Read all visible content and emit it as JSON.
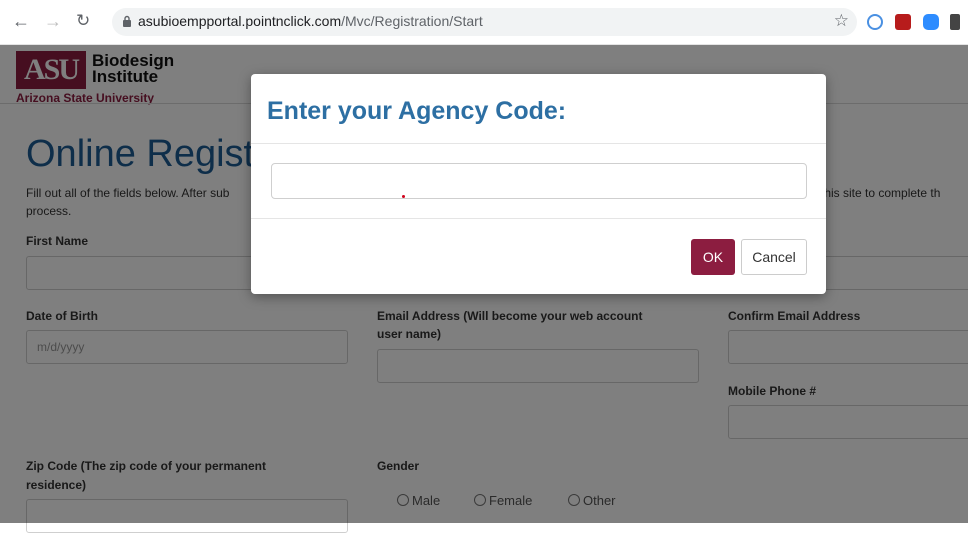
{
  "browser": {
    "url_host": "asubioempportal.pointnclick.com",
    "url_path": "/Mvc/Registration/Start",
    "icons": [
      "back-icon",
      "forward-icon",
      "reload-icon",
      "lock-icon",
      "star-icon"
    ]
  },
  "header": {
    "logo_mark": "ASU",
    "logo_line1": "Biodesign",
    "logo_line2": "Institute",
    "logo_sub": "Arizona State University"
  },
  "page": {
    "title": "Online Registr",
    "intro_left": "Fill out all of the fields below. After sub",
    "intro_right": "n this site to complete th",
    "intro_line2": "process."
  },
  "form": {
    "first_name_label": "First Name",
    "dob_label": "Date of Birth",
    "dob_placeholder": "m/d/yyyy",
    "email_label_1": "Email Address (Will become your web account",
    "email_label_2": "user name)",
    "confirm_email_label": "Confirm Email Address",
    "mobile_label": "Mobile Phone #",
    "zip_label_1": "Zip Code (The zip code of your permanent",
    "zip_label_2": "residence)",
    "gender_label": "Gender",
    "gender_options": [
      "Male",
      "Female",
      "Other"
    ]
  },
  "modal": {
    "title": "Enter your Agency Code:",
    "input_value": "",
    "ok_label": "OK",
    "cancel_label": "Cancel"
  },
  "colors": {
    "asu_maroon": "#8c1d40",
    "title_blue": "#2d6fa3"
  }
}
